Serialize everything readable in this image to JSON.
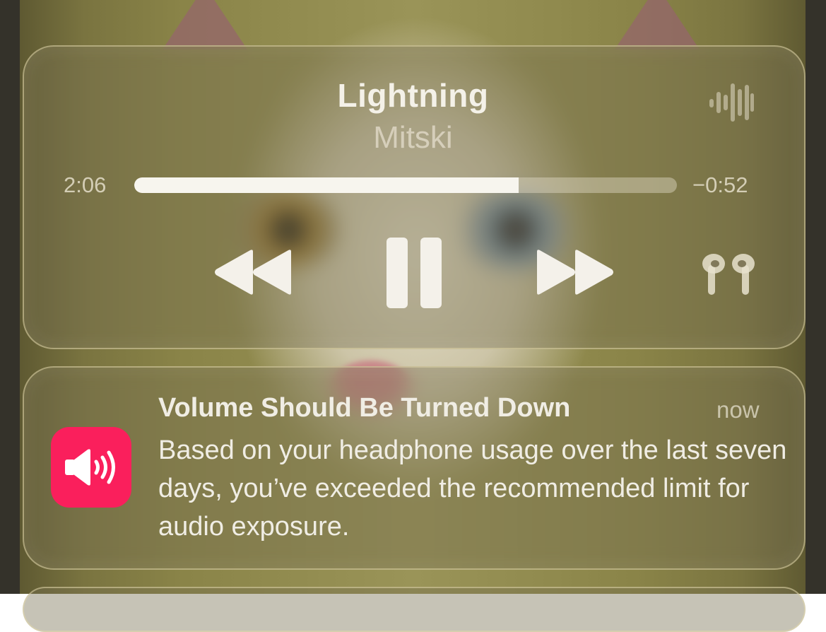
{
  "now_playing": {
    "title": "Lightning",
    "artist": "Mitski",
    "elapsed": "2:06",
    "remaining": "−0:52",
    "progress_fraction": 0.708,
    "controls": {
      "rewind_icon": "rewind-icon",
      "pause_icon": "pause-icon",
      "forward_icon": "fast-forward-icon",
      "output_icon": "airpods-icon",
      "visualizer_icon": "waveform-icon"
    }
  },
  "notification": {
    "app_icon": "speaker-volume-icon",
    "app_icon_color": "#fa1f5c",
    "title": "Volume Should Be Turned Down",
    "time": "now",
    "body": "Based on your headphone usage over the last seven days, you’ve exceeded the recommended limit for audio exposure."
  }
}
